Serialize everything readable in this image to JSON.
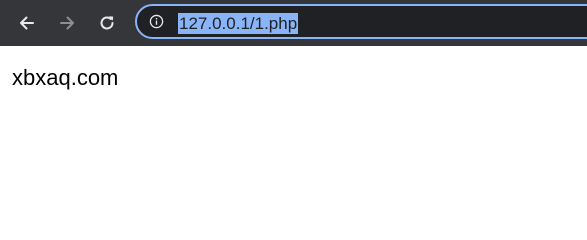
{
  "browser": {
    "address_bar": {
      "url": "127.0.0.1/1.php"
    },
    "nav": {
      "back_icon": "arrow-left-icon",
      "forward_icon": "arrow-right-icon",
      "reload_icon": "reload-icon",
      "site_info_icon": "info-icon"
    },
    "colors": {
      "toolbar": "#35363a",
      "omnibox_bg": "#202124",
      "omnibox_border": "#8ab4f8",
      "selection": "#8ab4f8"
    }
  },
  "page": {
    "content_text": "xbxaq.com"
  }
}
